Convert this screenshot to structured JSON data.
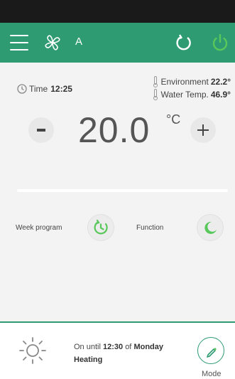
{
  "colors": {
    "brand": "#2e9b72",
    "accent_icon": "#59c85a",
    "background": "#f3f3f3"
  },
  "header": {
    "mode_letter": "A",
    "icons": [
      "menu-icon",
      "fan-icon",
      "refresh-icon",
      "power-icon"
    ]
  },
  "time": {
    "label": "Time",
    "value": "12:25"
  },
  "environment": {
    "label": "Environment",
    "value": "22.2°"
  },
  "water": {
    "label": "Water Temp.",
    "value": "46.9°"
  },
  "setpoint": {
    "value": "20.0",
    "unit": "°C"
  },
  "controls": {
    "week_program_label": "Week program",
    "function_label": "Function"
  },
  "status": {
    "prefix": "On until",
    "until_time": "12:30",
    "middle": "of",
    "day": "Monday",
    "mode_text": "Heating"
  },
  "mode_button": {
    "label": "Mode"
  }
}
